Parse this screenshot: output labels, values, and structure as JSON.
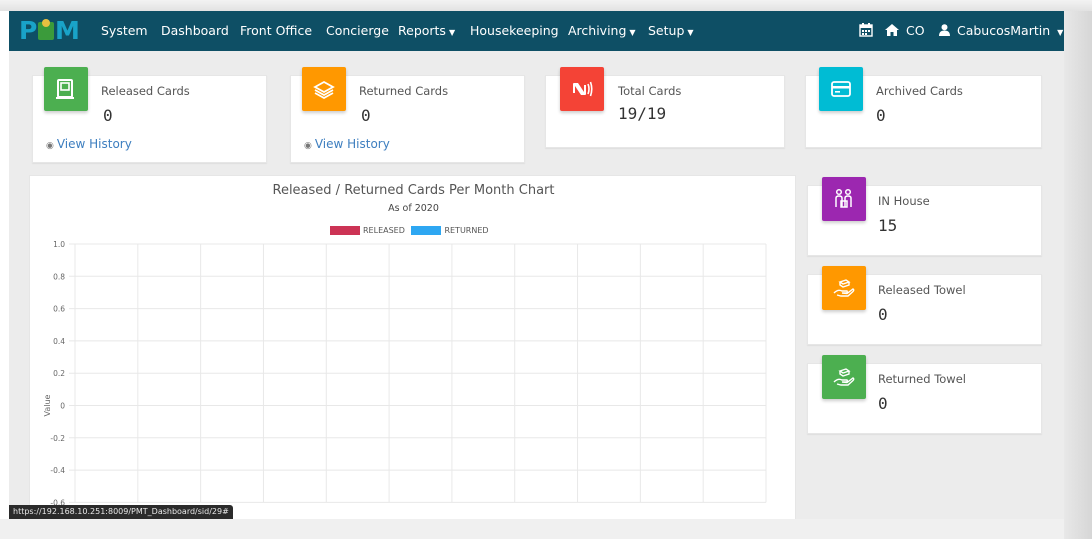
{
  "navbar": {
    "logo_left": "P",
    "logo_right": "M",
    "items": [
      {
        "label": "System",
        "dropdown": false
      },
      {
        "label": "Dashboard",
        "dropdown": false
      },
      {
        "label": "Front Office",
        "dropdown": false
      },
      {
        "label": "Concierge",
        "dropdown": false
      },
      {
        "label": "Reports",
        "dropdown": true
      },
      {
        "label": "Housekeeping",
        "dropdown": false
      },
      {
        "label": "Archiving",
        "dropdown": true
      },
      {
        "label": "Setup",
        "dropdown": true
      }
    ],
    "right": {
      "calendar_icon": "calendar-icon",
      "home_label": "CO",
      "user_label": "CabucosMartin"
    }
  },
  "cards": {
    "released": {
      "label": "Released Cards",
      "value": "0",
      "link": "View History",
      "color": "#4caf50",
      "icon": "card-release-icon"
    },
    "returned": {
      "label": "Returned Cards",
      "value": "0",
      "link": "View History",
      "color": "#ff9800",
      "icon": "card-stack-icon"
    },
    "total": {
      "label": "Total Cards",
      "value": "19/19",
      "color": "#f44336",
      "icon": "nfc-icon"
    },
    "archived": {
      "label": "Archived Cards",
      "value": "0",
      "color": "#00bcd4",
      "icon": "credit-card-icon"
    }
  },
  "side_cards": {
    "in_house": {
      "label": "IN House",
      "value": "15",
      "color": "#9c27b0",
      "icon": "guests-icon"
    },
    "released_towel": {
      "label": "Released Towel",
      "value": "0",
      "color": "#ff9800",
      "icon": "towel-hand-icon"
    },
    "returned_towel": {
      "label": "Returned Towel",
      "value": "0",
      "color": "#4caf50",
      "icon": "towel-hand-icon"
    }
  },
  "chart_data": {
    "type": "bar",
    "title": "Released / Returned Cards Per Month Chart",
    "subtitle": "As of 2020",
    "ylabel": "Value",
    "xlabel": "",
    "ylim": [
      -0.6,
      1.0
    ],
    "y_ticks": [
      "1.0",
      "0.8",
      "0.6",
      "0.4",
      "0.2",
      "0",
      "-0.2",
      "-0.4",
      "-0.6"
    ],
    "grid": true,
    "legend_position": "top",
    "series": [
      {
        "name": "RELEASED",
        "color": "#cc3355",
        "values": []
      },
      {
        "name": "RETURNED",
        "color": "#2ea7f2",
        "values": []
      }
    ]
  },
  "status_url": "https://192.168.10.251:8009/PMT_Dashboard/sid/29#"
}
